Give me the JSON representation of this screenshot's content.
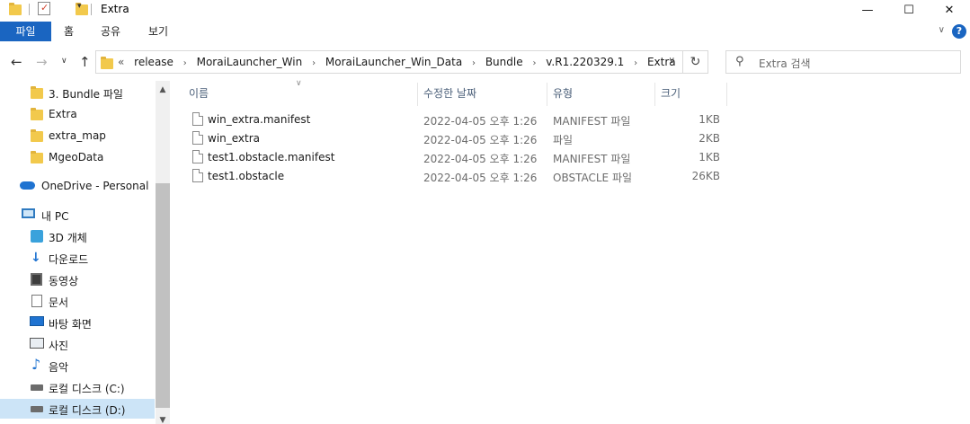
{
  "window": {
    "title": "Extra",
    "minimize_glyph": "—",
    "maximize_glyph": "☐",
    "close_glyph": "✕"
  },
  "ribbon": {
    "tabs": [
      "파일",
      "홈",
      "공유",
      "보기"
    ],
    "help_glyph": "?",
    "expand_glyph": "∨"
  },
  "address": {
    "back_glyph": "←",
    "forward_glyph": "→",
    "recent_glyph": "∨",
    "up_glyph": "↑",
    "overflow": "«",
    "breadcrumbs": [
      "release",
      "MoraiLauncher_Win",
      "MoraiLauncher_Win_Data",
      "Bundle",
      "v.R1.220329.1",
      "Extra"
    ],
    "separator": "›",
    "dropdown_glyph": "∨",
    "refresh_glyph": "↻"
  },
  "search": {
    "placeholder": "Extra 검색",
    "icon": "search-icon",
    "glyph": "⚲"
  },
  "nav": {
    "items": [
      {
        "label": "3. Bundle 파일",
        "icon": "folder-icon"
      },
      {
        "label": "Extra",
        "icon": "folder-icon"
      },
      {
        "label": "extra_map",
        "icon": "folder-icon"
      },
      {
        "label": "MgeoData",
        "icon": "folder-icon"
      },
      {
        "label": "OneDrive - Personal",
        "icon": "onedrive-icon"
      },
      {
        "label": "내 PC",
        "icon": "pc-icon"
      },
      {
        "label": "3D 개체",
        "icon": "3d-objects-icon"
      },
      {
        "label": "다운로드",
        "icon": "download-icon"
      },
      {
        "label": "동영상",
        "icon": "video-icon"
      },
      {
        "label": "문서",
        "icon": "document-icon"
      },
      {
        "label": "바탕 화면",
        "icon": "desktop-icon"
      },
      {
        "label": "사진",
        "icon": "picture-icon"
      },
      {
        "label": "음악",
        "icon": "music-icon"
      },
      {
        "label": "로컬 디스크 (C:)",
        "icon": "drive-icon"
      },
      {
        "label": "로컬 디스크 (D:)",
        "icon": "drive-icon"
      }
    ],
    "selected": "로컬 디스크 (D:)",
    "scroll_up": "▲",
    "scroll_down": "▼"
  },
  "columns": {
    "name": "이름",
    "date": "수정한 날짜",
    "type": "유형",
    "size": "크기",
    "sort_glyph": "∨"
  },
  "files": [
    {
      "name": "win_extra.manifest",
      "date": "2022-04-05 오후 1:26",
      "type": "MANIFEST 파일",
      "size": "1KB"
    },
    {
      "name": "win_extra",
      "date": "2022-04-05 오후 1:26",
      "type": "파일",
      "size": "2KB"
    },
    {
      "name": "test1.obstacle.manifest",
      "date": "2022-04-05 오후 1:26",
      "type": "MANIFEST 파일",
      "size": "1KB"
    },
    {
      "name": "test1.obstacle",
      "date": "2022-04-05 오후 1:26",
      "type": "OBSTACLE 파일",
      "size": "26KB"
    }
  ],
  "colors": {
    "accent": "#1a65c1",
    "folder": "#f2c94c",
    "selection": "#cce4f7",
    "header_text": "#4c607a"
  }
}
